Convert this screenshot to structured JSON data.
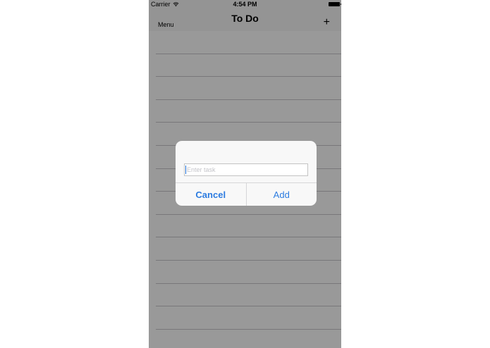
{
  "status_bar": {
    "carrier": "Carrier",
    "time": "4:54 PM"
  },
  "nav": {
    "menu_label": "Menu",
    "title": "To Do",
    "add_label": "+"
  },
  "table": {
    "row_count": 14
  },
  "alert": {
    "input_placeholder": "Enter task",
    "input_value": "",
    "cancel_label": "Cancel",
    "add_label": "Add"
  },
  "colors": {
    "accent": "#2c7be0",
    "separator": "#c8c7cc",
    "overlay": "rgba(0,0,0,0.4)"
  }
}
